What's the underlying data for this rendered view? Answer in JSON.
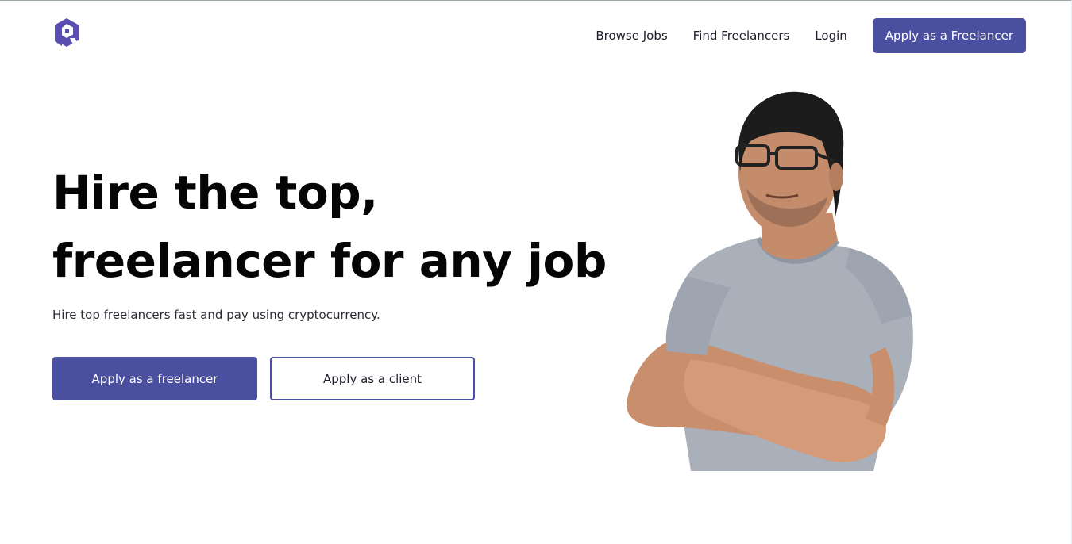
{
  "nav": {
    "links": [
      "Browse Jobs",
      "Find Freelancers",
      "Login"
    ],
    "cta_label": "Apply as a Freelancer"
  },
  "hero": {
    "title_line1": "Hire the top,",
    "title_line2": "freelancer for any job",
    "subtitle": "Hire top freelancers fast and pay using cryptocurrency.",
    "primary_button": "Apply as a freelancer",
    "secondary_button": "Apply as a client"
  },
  "colors": {
    "accent": "#4b4f9f",
    "text": "#050505",
    "background": "#ffffff"
  },
  "icons": {
    "logo": "hexagon-logo-icon"
  }
}
